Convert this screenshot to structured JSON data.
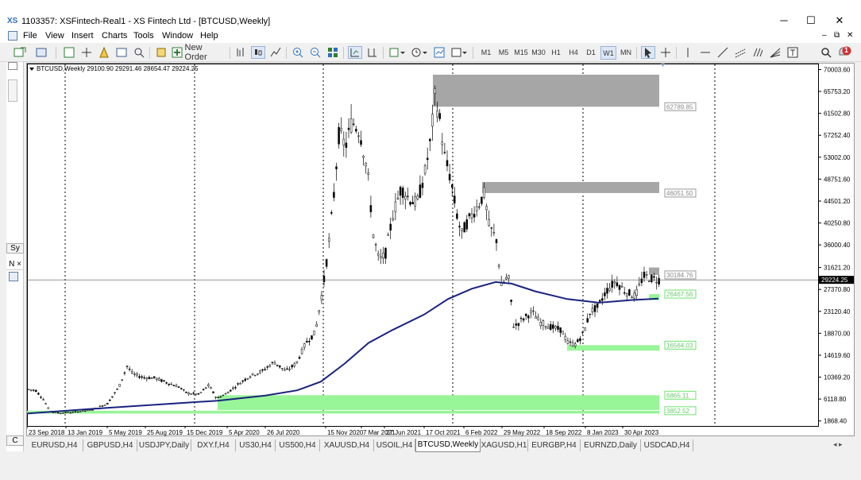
{
  "app": {
    "logo": "XS",
    "title": "1103357: XSFintech-Real1 - XS Fintech Ltd - [BTCUSD,Weekly]"
  },
  "window_buttons": {
    "minimize": "─",
    "maximize": "☐",
    "close": "✕"
  },
  "menu": [
    "File",
    "View",
    "Insert",
    "Charts",
    "Tools",
    "Window",
    "Help"
  ],
  "mdi_buttons": {
    "minimize": "–",
    "restore": "⧉",
    "close": "✕"
  },
  "toolbar": {
    "new_order": "New Order",
    "alert_badge": "1"
  },
  "timeframes": [
    "M1",
    "M5",
    "M15",
    "M30",
    "H1",
    "H4",
    "D1",
    "W1",
    "MN"
  ],
  "active_timeframe": "W1",
  "left_panel": {
    "tab1": "Sy",
    "tab2": "C"
  },
  "chart": {
    "header": "BTCUSD,Weekly  29100.90 29291.46 28654.47 29224.25",
    "symbol": "BTCUSD",
    "current_price": "29224.25",
    "y_ticks": [
      "70003.60",
      "65753.20",
      "61502.80",
      "57252.40",
      "53002.00",
      "48751.60",
      "44501.20",
      "40250.80",
      "36000.40",
      "31621.20",
      "27370.80",
      "23120.40",
      "18870.00",
      "14619.60",
      "10369.20",
      "6118.80",
      "1868.40"
    ],
    "x_ticks": [
      "23 Sep 2018",
      "13 Jan 2019",
      "5 May 2019",
      "25 Aug 2019",
      "15 Dec 2019",
      "5 Apr 2020",
      "26 Jul 2020",
      "15 Nov 2020",
      "7 Mar 2021",
      "27 Jun 2021",
      "17 Oct 2021",
      "6 Feb 2022",
      "29 May 2022",
      "18 Sep 2022",
      "8 Jan 2023",
      "30 Apr 2023"
    ],
    "zones": [
      {
        "type": "supply",
        "label": "62789.85",
        "top": 69000,
        "bottom": 62789.85,
        "color": "#a6a6a6"
      },
      {
        "type": "supply",
        "label": "46051.50",
        "top": 48200,
        "bottom": 46051.5,
        "color": "#a6a6a6"
      },
      {
        "type": "supply",
        "label": "30184.76",
        "top": 31621,
        "bottom": 30184.76,
        "color": "#a6a6a6"
      },
      {
        "type": "demand",
        "label": "26467.56",
        "top": 26467.56,
        "bottom": 25300,
        "color": "#98f598"
      },
      {
        "type": "demand",
        "label": "16564.03",
        "top": 16564.03,
        "bottom": 15500,
        "color": "#98f598"
      },
      {
        "type": "demand",
        "label": "6865.11",
        "top": 6865.11,
        "bottom": 4000,
        "color": "#98f598"
      },
      {
        "type": "demand",
        "label": "3852.52",
        "top": 3852.52,
        "bottom": 3300,
        "color": "#98f598"
      }
    ],
    "colors": {
      "candles": "#000000",
      "ma": "#1a237e",
      "grid": "#000000",
      "price_tag_bg": "#000000",
      "price_tag_fg": "#ffffff"
    }
  },
  "tabs": [
    "EURUSD,H4",
    "GBPUSD,H4",
    "USDJPY,Daily",
    "DXY.f,H4",
    "US30,H4",
    "US500,H4",
    "XAUUSD,H4",
    "USOIL,H4",
    "BTCUSD,Weekly",
    "XAGUSD,H1",
    "EURGBP,H4",
    "EURNZD,Daily",
    "USDCAD,H4"
  ],
  "active_tab": "BTCUSD,Weekly"
}
